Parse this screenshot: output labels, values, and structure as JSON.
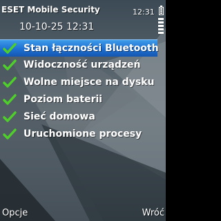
{
  "status_bar": {
    "app_title": "ESET Mobile Security",
    "clock": "12:31"
  },
  "subtitle": "10-10-25 12:31",
  "list": {
    "items": [
      {
        "label": "Stan łączności Bluetooth",
        "selected": true
      },
      {
        "label": "Widoczność urządzeń",
        "selected": false
      },
      {
        "label": "Wolne miejsce na dysku",
        "selected": false
      },
      {
        "label": "Poziom baterii",
        "selected": false
      },
      {
        "label": "Sieć domowa",
        "selected": false
      },
      {
        "label": "Uruchomione procesy",
        "selected": false
      }
    ]
  },
  "softkeys": {
    "left": "Opcje",
    "right": "Wróć"
  },
  "colors": {
    "highlight": "#1d6fd3",
    "check": "#4fcf2a"
  },
  "icons": {
    "item_status": "check-icon",
    "battery": "battery-icon",
    "signal": "signal-strength-icon"
  }
}
